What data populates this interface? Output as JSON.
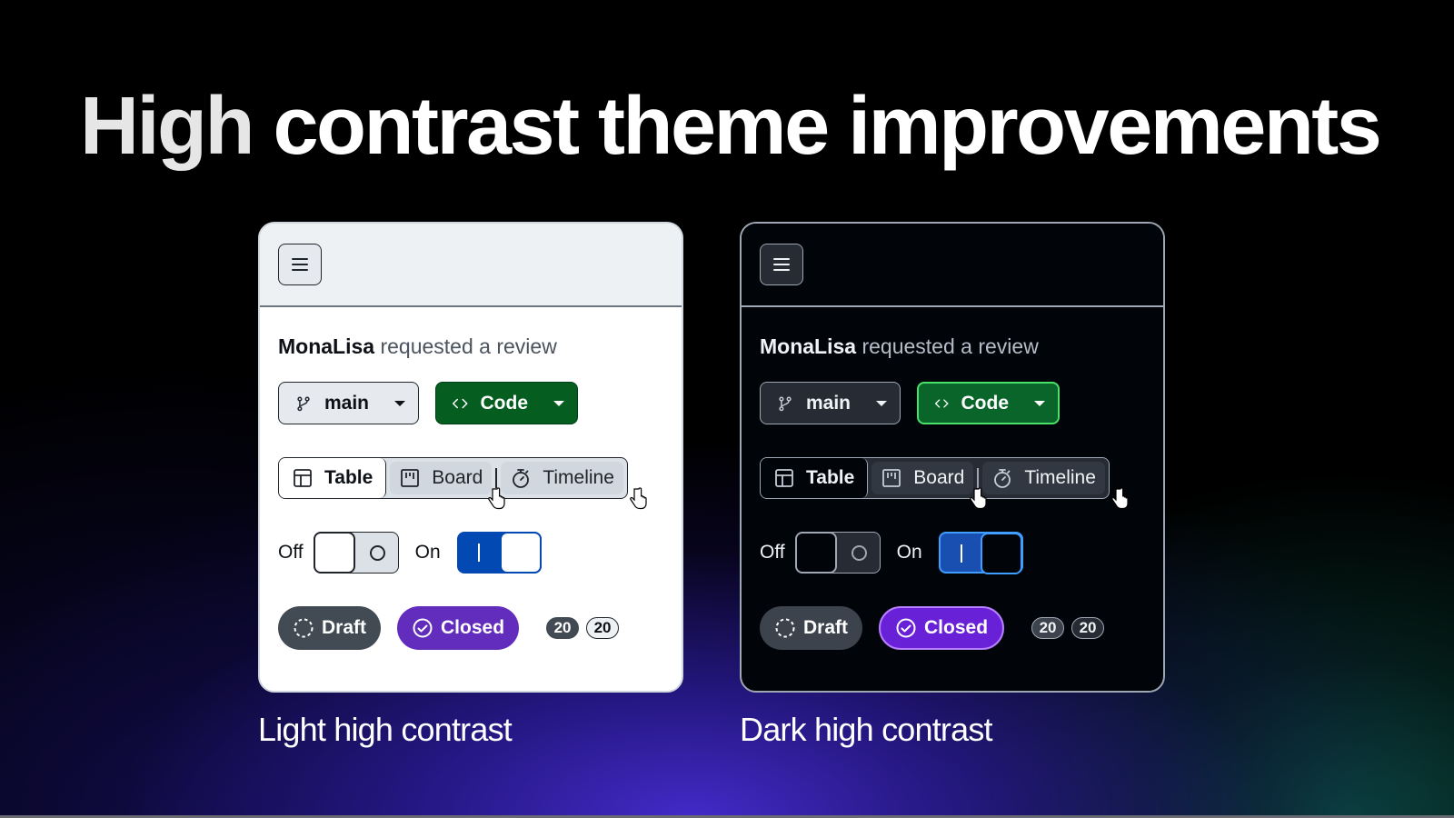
{
  "headline": {
    "first_word": "High",
    "rest": "contrast theme improvements"
  },
  "panels": [
    {
      "theme": "light",
      "caption": "Light high contrast",
      "header": {
        "menu_icon": "hamburger-icon"
      },
      "review": {
        "user": "MonaLisa",
        "action": "requested a review"
      },
      "branch_button": {
        "label": "main",
        "icon": "git-branch-icon"
      },
      "code_button": {
        "label": "Code",
        "icon": "code-icon"
      },
      "segmented": {
        "items": [
          {
            "label": "Table",
            "icon": "table-icon",
            "selected": true
          },
          {
            "label": "Board",
            "icon": "project-board-icon",
            "selected": false
          },
          {
            "label": "Timeline",
            "icon": "stopwatch-icon",
            "selected": false
          }
        ]
      },
      "toggles": {
        "off_label": "Off",
        "on_label": "On",
        "off_state": false,
        "on_state": true
      },
      "labels": {
        "draft": "Draft",
        "closed": "Closed",
        "counter_primary": "20",
        "counter_secondary": "20"
      }
    },
    {
      "theme": "dark",
      "caption": "Dark high contrast",
      "header": {
        "menu_icon": "hamburger-icon"
      },
      "review": {
        "user": "MonaLisa",
        "action": "requested a review"
      },
      "branch_button": {
        "label": "main",
        "icon": "git-branch-icon"
      },
      "code_button": {
        "label": "Code",
        "icon": "code-icon"
      },
      "segmented": {
        "items": [
          {
            "label": "Table",
            "icon": "table-icon",
            "selected": true
          },
          {
            "label": "Board",
            "icon": "project-board-icon",
            "selected": false
          },
          {
            "label": "Timeline",
            "icon": "stopwatch-icon",
            "selected": false
          }
        ]
      },
      "toggles": {
        "off_label": "Off",
        "on_label": "On",
        "off_state": false,
        "on_state": true
      },
      "labels": {
        "draft": "Draft",
        "closed": "Closed",
        "counter_primary": "20",
        "counter_secondary": "20"
      }
    }
  ],
  "colors": {
    "light_code_green": "#055d20",
    "dark_code_green": "#09652a",
    "light_toggle_blue": "#0349b4",
    "dark_toggle_blue": "#194fb1",
    "light_closed_purple": "#622cbc",
    "dark_closed_purple": "#6921d7",
    "draft_gray": "#424a53"
  }
}
